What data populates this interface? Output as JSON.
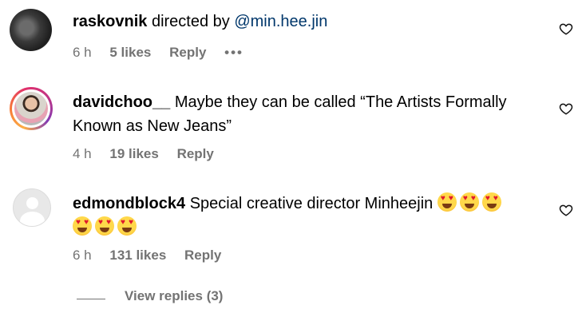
{
  "comments": [
    {
      "username": "raskovnik",
      "text_pre": " directed by ",
      "mention": "@min.hee.jin",
      "time": "6 h",
      "likes": "5 likes",
      "reply": "Reply",
      "more": "•••"
    },
    {
      "username": "davidchoo__",
      "line1": " Maybe they can be called “The Artists Formally",
      "line2": "Known as New Jeans”",
      "time": "4 h",
      "likes": "19 likes",
      "reply": "Reply"
    },
    {
      "username": "edmondblock4",
      "text": " Special creative director Minheejin",
      "time": "6 h",
      "likes": "131 likes",
      "reply": "Reply"
    }
  ],
  "view_replies": "View replies (3)",
  "icons": {
    "like": "heart-outline-icon",
    "emoji": "heart-eyes-emoji"
  }
}
